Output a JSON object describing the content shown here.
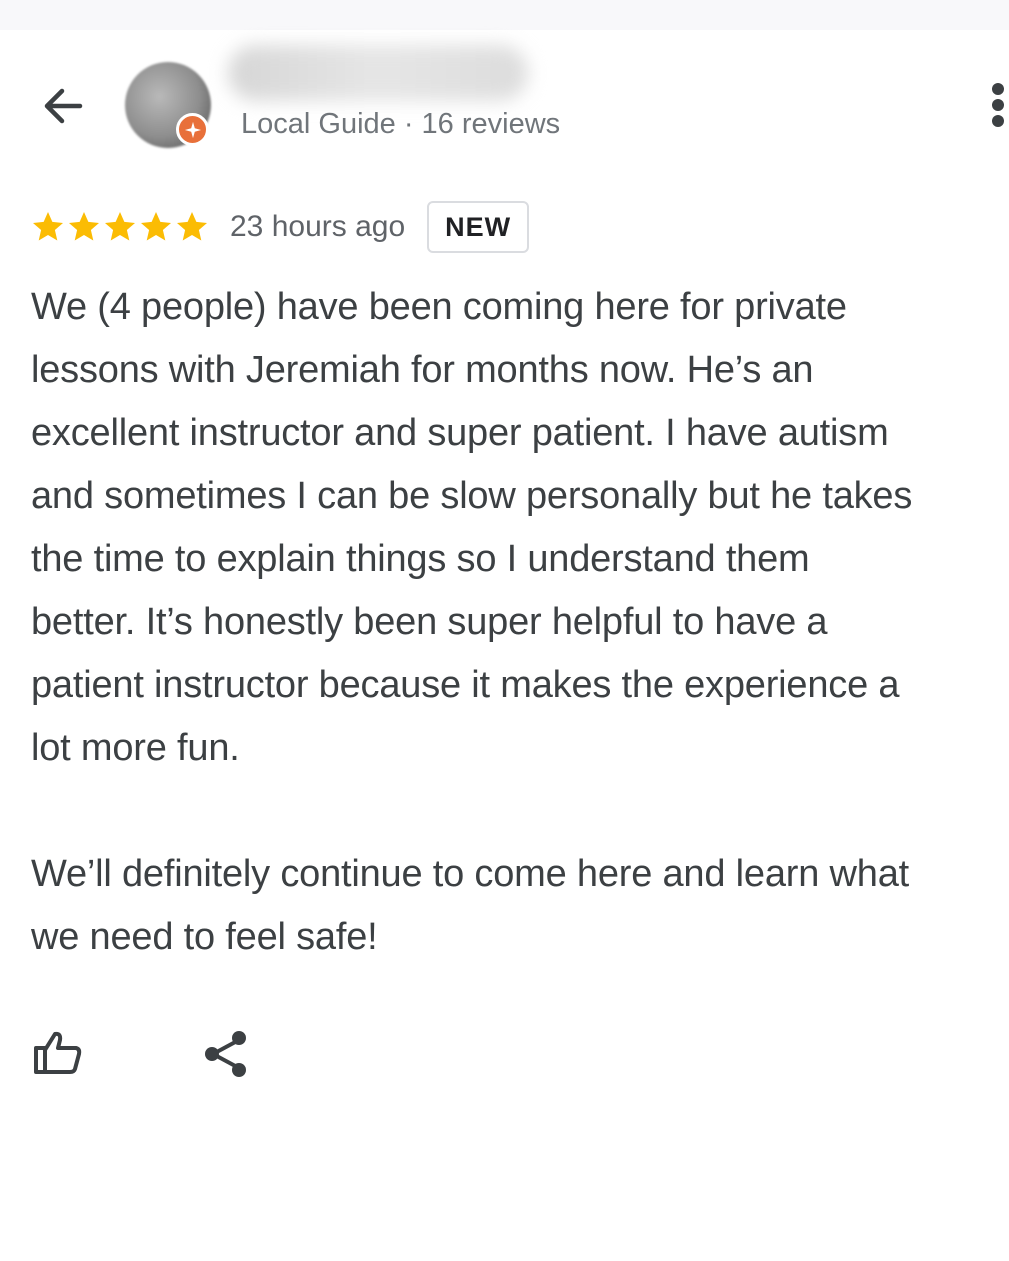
{
  "reviewer": {
    "meta": "Local Guide · 16 reviews"
  },
  "review": {
    "rating": 5,
    "rating_max": 5,
    "time_ago": "23 hours ago",
    "badge": "NEW",
    "lines": [
      "We (4 people) have been coming here for private",
      "lessons with Jeremiah for months now. He’s an",
      "excellent instructor and super patient. I have autism",
      "and sometimes I can be slow personally but he takes",
      "the time to explain things so I understand them",
      "better. It’s honestly been super helpful to have a",
      "patient instructor because it makes the experience a",
      "lot more fun.",
      "",
      "We’ll definitely continue to come here and learn what",
      "we need to feel safe!"
    ]
  },
  "icons": {
    "back": "arrow-left-icon",
    "more": "more-vert-icon",
    "like": "thumb-up-icon",
    "share": "share-icon",
    "guide_badge": "local-guide-star-icon"
  },
  "colors": {
    "star": "#fbbc04",
    "guide_badge": "#e8703a",
    "text": "#3c4043",
    "secondary_text": "#70757a"
  }
}
